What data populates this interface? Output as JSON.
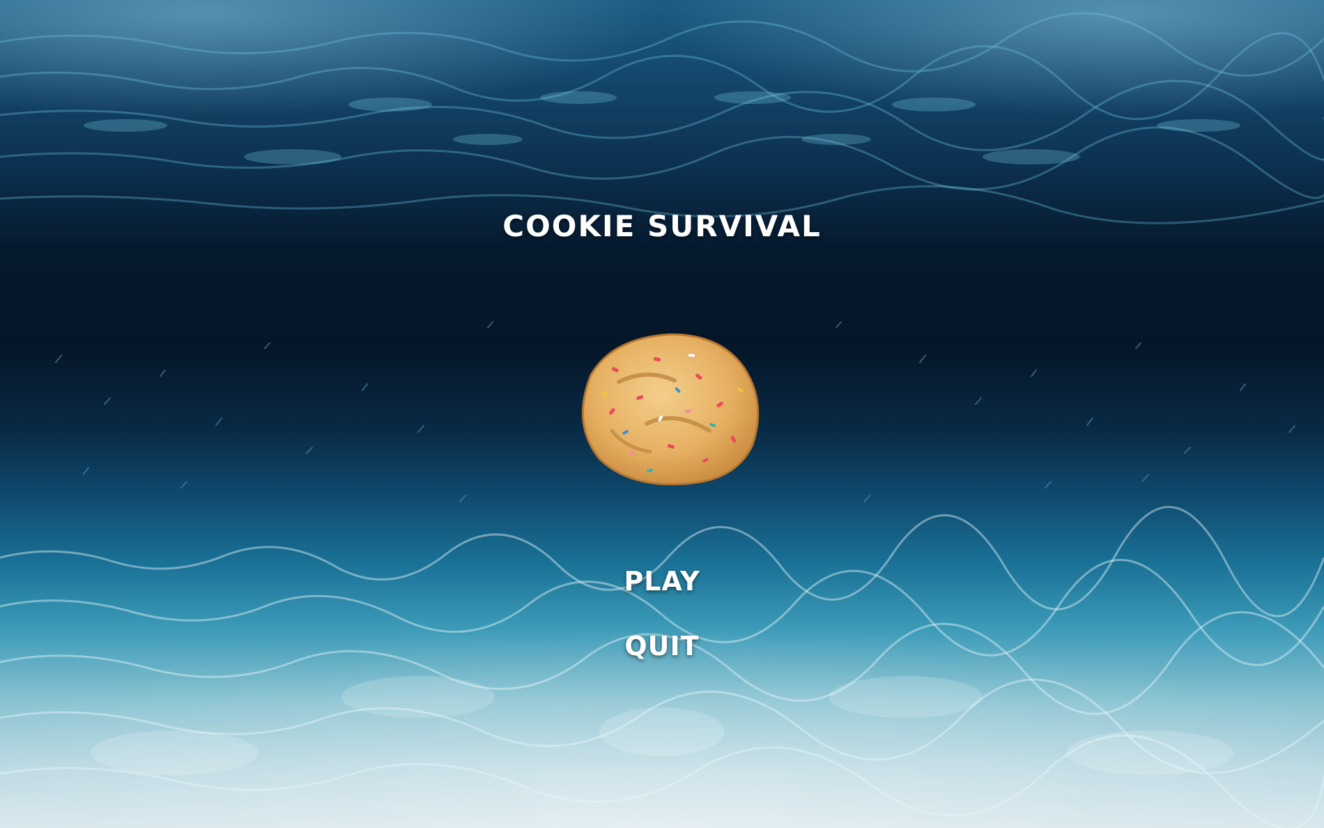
{
  "game": {
    "title": "COOKIE SURVIVAL"
  },
  "menu": {
    "play_label": "PLAY",
    "quit_label": "QUIT"
  },
  "colors": {
    "deep_water": "#061a2e",
    "mid_water": "#0f4f78",
    "shallow_water": "#7fd3e6",
    "sand_light": "#d8ecf2",
    "text": "#ffffff",
    "cookie_dough": "#e8b66a"
  },
  "icons": {
    "cookie": "cookie-icon"
  }
}
